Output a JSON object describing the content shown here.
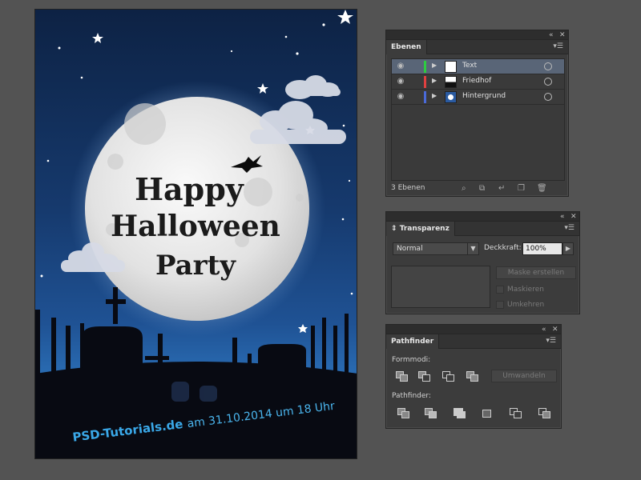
{
  "poster": {
    "line1": "Happy",
    "line2": "Halloween",
    "line3": "Party",
    "site": "PSD-Tutorials.de",
    "date": "am 31.10.2014 um 18 Uhr",
    "colors": {
      "moon": "#e8e8e8",
      "site_text": "#3aa8e8",
      "date_text": "#4ab4ec"
    }
  },
  "layers_panel": {
    "tab": "Ebenen",
    "layers": [
      {
        "name": "Text",
        "color": "#2ecc40",
        "selected": true
      },
      {
        "name": "Friedhof",
        "color": "#e04040",
        "selected": false
      },
      {
        "name": "Hintergrund",
        "color": "#4a6ad8",
        "selected": false
      }
    ],
    "count_label": "3 Ebenen"
  },
  "transparency_panel": {
    "tab": "Transparenz",
    "blend_mode": "Normal",
    "opacity_label": "Deckkraft:",
    "opacity_value": "100%",
    "make_mask": "Maske erstellen",
    "clip": "Maskieren",
    "invert": "Umkehren"
  },
  "pathfinder_panel": {
    "tab": "Pathfinder",
    "shape_modes_label": "Formmodi:",
    "pathfinder_label": "Pathfinder:",
    "convert": "Umwandeln"
  },
  "icons": {
    "collapse": "double-left-arrow-icon",
    "close": "close-icon",
    "menu": "panel-menu-icon"
  }
}
